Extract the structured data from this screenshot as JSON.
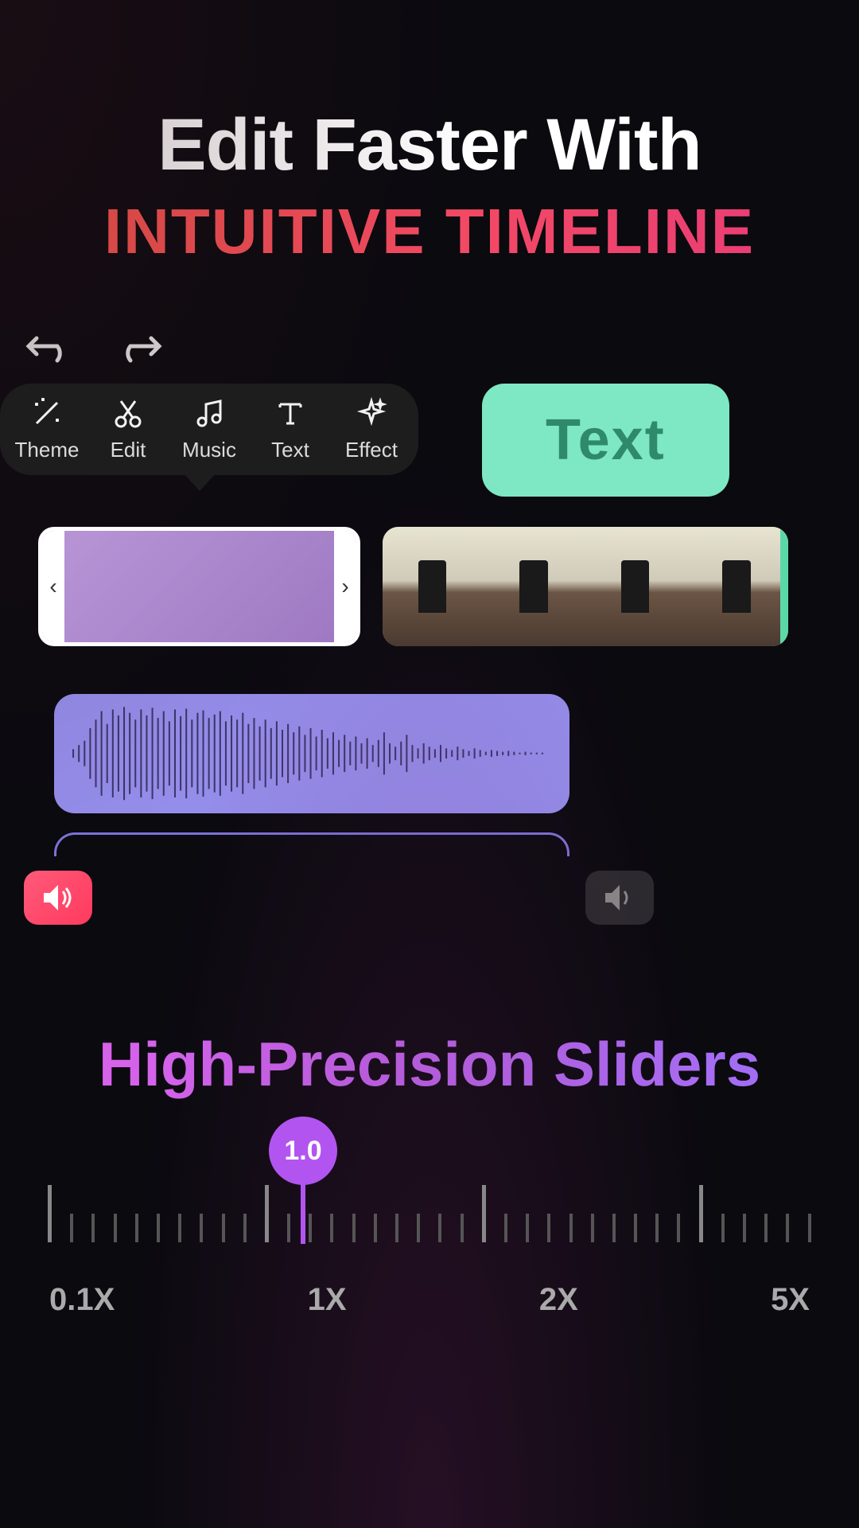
{
  "headline": {
    "top": "Edit Faster With",
    "bottom": "INTUITIVE TIMELINE"
  },
  "toolbar": {
    "items": [
      {
        "label": "Theme",
        "icon": "wand-icon"
      },
      {
        "label": "Edit",
        "icon": "scissors-icon"
      },
      {
        "label": "Music",
        "icon": "music-icon"
      },
      {
        "label": "Text",
        "icon": "text-icon"
      },
      {
        "label": "Effect",
        "icon": "sparkle-icon"
      }
    ]
  },
  "text_pill": {
    "label": "Text"
  },
  "clip_handles": {
    "left": "‹",
    "right": "›"
  },
  "slider": {
    "title": "High-Precision Sliders",
    "value_label": "1.0",
    "labels": [
      "0.1X",
      "1X",
      "2X",
      "5X"
    ]
  }
}
